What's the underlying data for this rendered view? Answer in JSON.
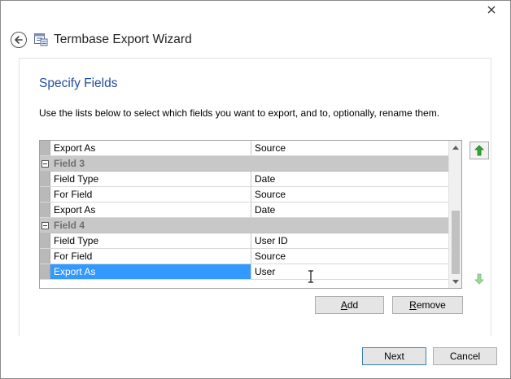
{
  "window": {
    "title": "Termbase Export Wizard"
  },
  "page": {
    "title": "Specify Fields",
    "instructions": "Use the lists below to select which fields you want to export, and to, optionally, rename them."
  },
  "grid": {
    "rows": [
      {
        "type": "property",
        "name": "Export As",
        "value": "Source"
      },
      {
        "type": "category",
        "name": "Field 3"
      },
      {
        "type": "property",
        "name": "Field Type",
        "value": "Date"
      },
      {
        "type": "property",
        "name": "For Field",
        "value": "Source"
      },
      {
        "type": "property",
        "name": "Export As",
        "value": "Date"
      },
      {
        "type": "category",
        "name": "Field 4"
      },
      {
        "type": "property",
        "name": "Field Type",
        "value": "User ID"
      },
      {
        "type": "property",
        "name": "For Field",
        "value": "Source"
      },
      {
        "type": "property",
        "name": "Export As",
        "value": "User",
        "selected": true
      }
    ]
  },
  "buttons": {
    "add": {
      "pre": "",
      "key": "A",
      "post": "dd"
    },
    "remove": {
      "pre": "",
      "key": "R",
      "post": "emove"
    },
    "next": "Next",
    "cancel": "Cancel"
  },
  "icons": {
    "close": "close-icon",
    "back": "back-arrow-icon",
    "app": "termbase-icon",
    "move_up": "green-arrow-up-icon",
    "move_down": "green-arrow-down-icon",
    "expand": "collapse-minus-icon"
  },
  "colors": {
    "title": "#1f4e9c",
    "selection": "#3399ff",
    "category": "#c8c8c8",
    "arrow_green": "#2fa82f"
  }
}
